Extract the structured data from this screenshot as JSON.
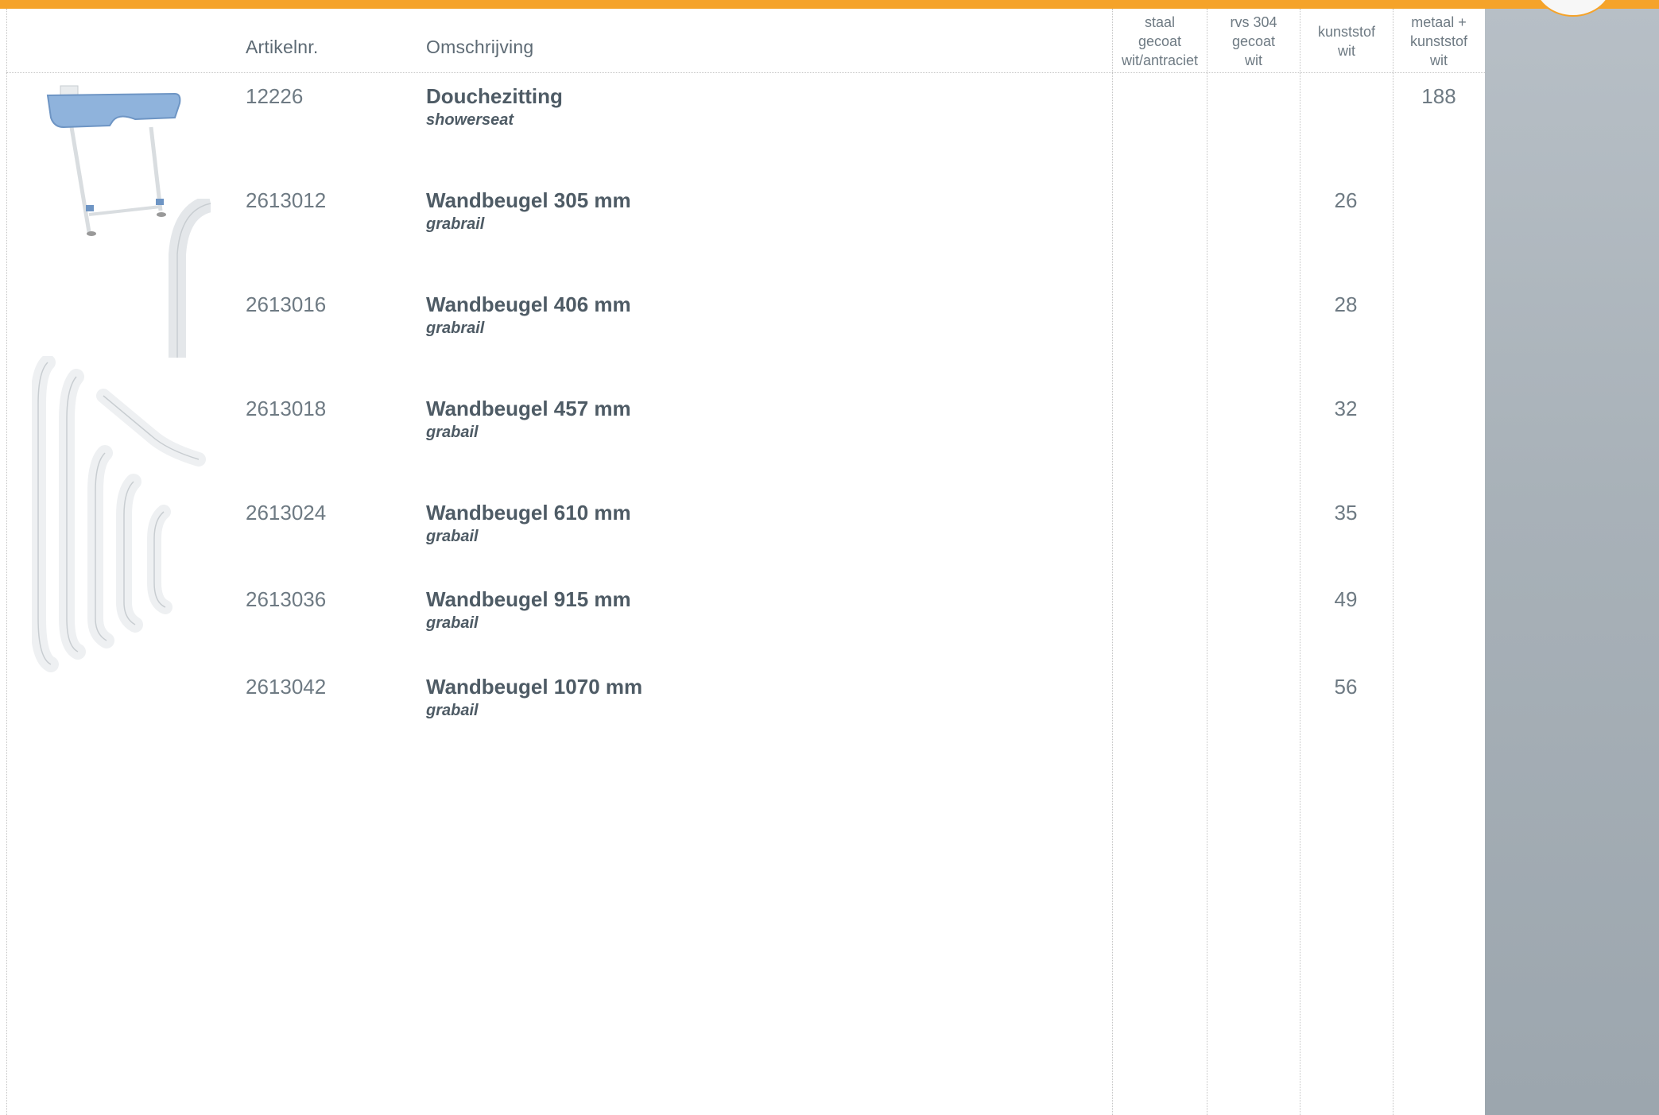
{
  "header": {
    "artikelnr": "Artikelnr.",
    "omschrijving": "Omschrijving",
    "col_staal": "staal\ngecoat\nwit/antraciet",
    "col_rvs": "rvs 304\ngecoat\nwit",
    "col_kunststof": "kunststof\nwit",
    "col_metaal": "metaal +\nkunststof\nwit"
  },
  "rows": [
    {
      "art": "12226",
      "title": "Douchezitting",
      "subtitle": "showerseat",
      "staal": "",
      "rvs": "",
      "kunststof": "",
      "metaal": "188"
    },
    {
      "art": "2613012",
      "title": "Wandbeugel 305 mm",
      "subtitle": "grabrail",
      "staal": "",
      "rvs": "",
      "kunststof": "26",
      "metaal": ""
    },
    {
      "art": "2613016",
      "title": "Wandbeugel 406 mm",
      "subtitle": "grabrail",
      "staal": "",
      "rvs": "",
      "kunststof": "28",
      "metaal": ""
    },
    {
      "art": "2613018",
      "title": "Wandbeugel 457 mm",
      "subtitle": "grabail",
      "staal": "",
      "rvs": "",
      "kunststof": "32",
      "metaal": ""
    },
    {
      "art": "2613024",
      "title": "Wandbeugel 610 mm",
      "subtitle": "grabail",
      "staal": "",
      "rvs": "",
      "kunststof": "35",
      "metaal": ""
    },
    {
      "art": "2613036",
      "title": "Wandbeugel 915 mm",
      "subtitle": "grabail",
      "staal": "",
      "rvs": "",
      "kunststof": "49",
      "metaal": ""
    },
    {
      "art": "2613042",
      "title": "Wandbeugel 1070 mm",
      "subtitle": "grabail",
      "staal": "",
      "rvs": "",
      "kunststof": "56",
      "metaal": ""
    }
  ],
  "colors": {
    "accent_bar": "#f5a32a",
    "sidebar": "#a8b1b8",
    "text": "#5d6a74",
    "seat_blue": "#8fb3dc"
  },
  "images": [
    "shower-seat-image",
    "grabrail-closeup-image",
    "grabrails-group-image"
  ]
}
